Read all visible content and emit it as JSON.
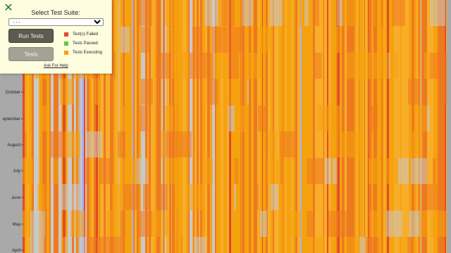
{
  "panel": {
    "title": "Select Test Suite:",
    "select_value": "- - -",
    "run_button": "Run Tests",
    "tests_button": "Tests",
    "legend": [
      {
        "label": "Test(s) Failed",
        "color": "#e8472c"
      },
      {
        "label": "Tests Passed",
        "color": "#55cc44"
      },
      {
        "label": "Tests Executing",
        "color": "#f5a20f"
      }
    ],
    "help_link": "Ask For Help",
    "close_icon": "close-x-icon"
  },
  "timeline": {
    "months": [
      "October",
      "eptember",
      "August",
      "July",
      "June",
      "May",
      "April"
    ],
    "colors": {
      "executing": "#f5a20f",
      "executing_light": "#f8ae2a",
      "failed": "#ee7a20",
      "failed_dark": "#e24a24",
      "idle": "#c9c9c9",
      "queued": "#aab0ee",
      "background": "#a9a9a9"
    }
  }
}
